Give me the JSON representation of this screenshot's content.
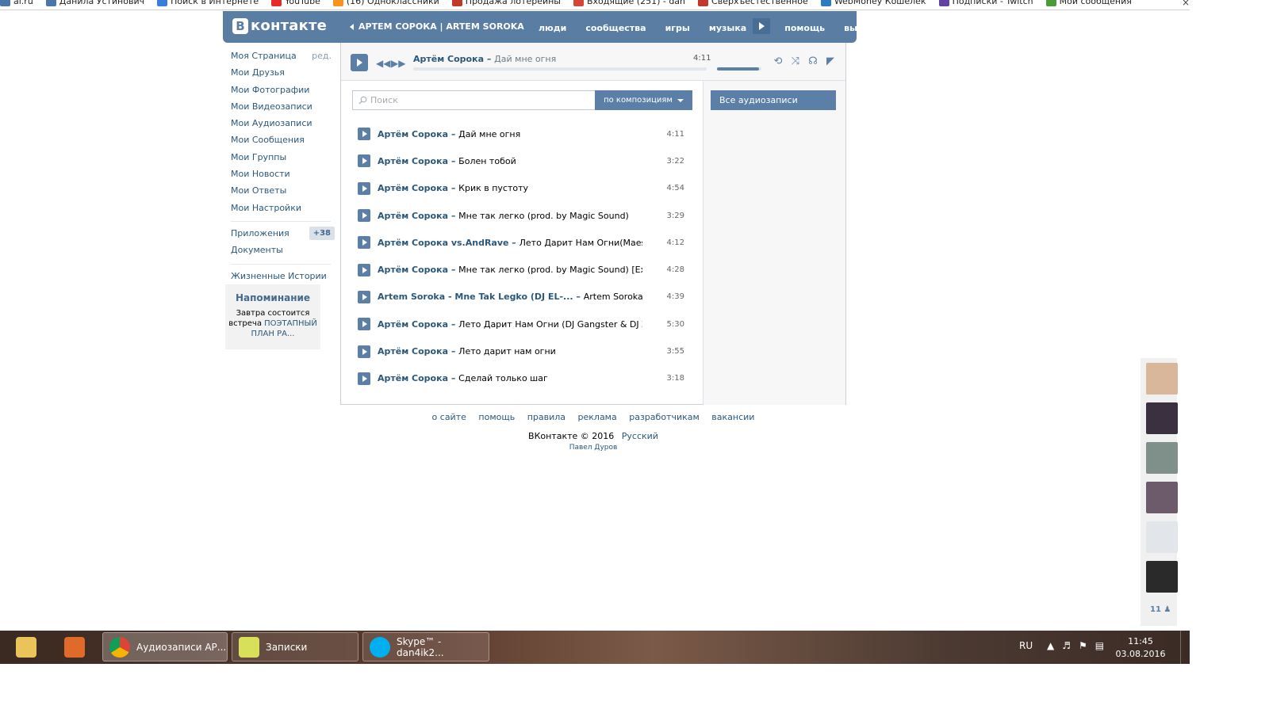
{
  "bookmarks": [
    {
      "label": "al.ru",
      "color": "#4a76a8"
    },
    {
      "label": "Данила Устинович",
      "color": "#4a76a8"
    },
    {
      "label": "Поиск в Интернете",
      "color": "#3b7ddd"
    },
    {
      "label": "YouTube",
      "color": "#e52d27"
    },
    {
      "label": "(16) Одноклассники",
      "color": "#f7931e"
    },
    {
      "label": "Продажа лотерейны",
      "color": "#c0392b"
    },
    {
      "label": "Входящие (251) - dan",
      "color": "#d44638"
    },
    {
      "label": "Сверхъестественное",
      "color": "#c0392b"
    },
    {
      "label": "WebMoney Кошелек",
      "color": "#2d7cc1"
    },
    {
      "label": "Подписки - Twitch",
      "color": "#6441a5"
    },
    {
      "label": "Мои сообщения",
      "color": "#4a9b3a"
    }
  ],
  "header": {
    "logo_letter": "В",
    "logo_text": "контакте",
    "now_playing": "АРТЕМ СОРОКА | ARTEM SOROKA",
    "nav": [
      "люди",
      "сообщества",
      "игры",
      "музыка",
      "помощь",
      "выйти"
    ]
  },
  "leftmenu": {
    "edit": "ред.",
    "items": [
      "Моя Страница",
      "Мои Друзья",
      "Мои Фотографии",
      "Мои Видеозаписи",
      "Мои Аудиозаписи",
      "Мои Сообщения",
      "Мои Группы",
      "Мои Новости",
      "Мои Ответы",
      "Мои Настройки"
    ],
    "apps": "Приложения",
    "apps_badge": "+38",
    "docs": "Документы",
    "stories": "Жизненные Истории"
  },
  "reminder": {
    "title": "Напоминание",
    "text_before": "Завтра состоится встреча",
    "link": "ПОЭТАПНЫЙ ПЛАН РА..."
  },
  "player": {
    "artist": "Артём Сорока",
    "separator": " – ",
    "song": "Дай мне огня",
    "time": "4:11",
    "progress": 0,
    "volume": 0.95
  },
  "search": {
    "placeholder": "Поиск",
    "mode": "по композициям"
  },
  "all_audio": "Все аудиозаписи",
  "tracks": [
    {
      "artist": "Артём Сорока",
      "title": "Дай мне огня",
      "duration": "4:11"
    },
    {
      "artist": "Артём Сорока",
      "title": "Болен тобой",
      "duration": "3:22"
    },
    {
      "artist": "Артём Сорока",
      "title": "Крик в пустоту",
      "duration": "4:54"
    },
    {
      "artist": "Артём Сорока",
      "title": "Мне так легко (prod. by Magic Sound)",
      "duration": "3:29"
    },
    {
      "artist": "Артём Сорока vs.AndRave",
      "title": "Лето Дарит Нам Огни(Maestro ...",
      "duration": "4:12"
    },
    {
      "artist": "Артём Сорока",
      "title": "Мне так легко (prod. by Magic Sound) [Extend...",
      "duration": "4:28"
    },
    {
      "artist": "Artem Soroka - Mne Tak Legko (DJ EL-...",
      "title": "Artem Soroka - ...",
      "duration": "4:39"
    },
    {
      "artist": "Артём Сорока",
      "title": "Лето Дарит Нам Огни (DJ Gangster & DJ Zing ...",
      "duration": "5:30"
    },
    {
      "artist": "Артём Сорока",
      "title": "Лето дарит нам огни",
      "duration": "3:55"
    },
    {
      "artist": "Артём Сорока",
      "title": "Сделай только шаг",
      "duration": "3:18"
    }
  ],
  "footer": {
    "links": [
      "о сайте",
      "помощь",
      "правила",
      "реклама",
      "разработчикам",
      "вакансии"
    ],
    "copyright": "ВКонтакте © 2016",
    "language": "Русский",
    "author": "Павел Дуров"
  },
  "friends": {
    "avatars": [
      "#d9b79a",
      "#3a3040",
      "#7f8f8a",
      "#6d5a6a",
      "#e2e6ea",
      "#2a2a2a"
    ],
    "count": "11"
  },
  "taskbar": {
    "windows": [
      "Аудиозаписи АР...",
      "Записки",
      "Skype™ - dan4ik2..."
    ],
    "lang": "RU",
    "time": "11:45",
    "date": "03.08.2016"
  }
}
